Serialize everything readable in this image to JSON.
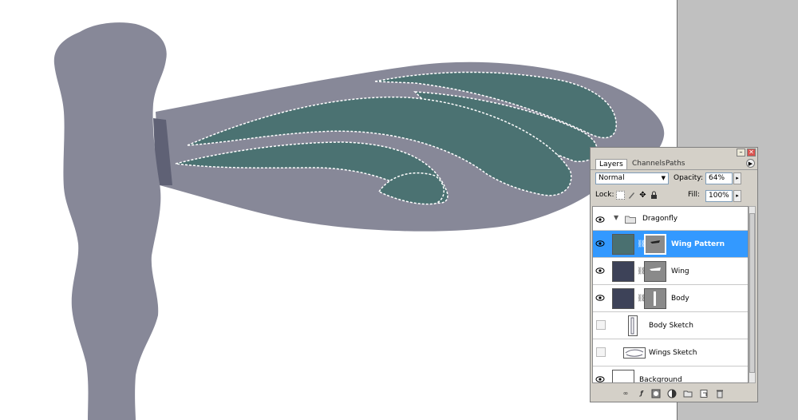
{
  "palette": {
    "tabs": [
      "Layers",
      "Channels",
      "Paths"
    ],
    "blend_mode": "Normal",
    "opacity_label": "Opacity:",
    "opacity_value": "64%",
    "lock_label": "Lock:",
    "fill_label": "Fill:",
    "fill_value": "100%"
  },
  "layers": [
    {
      "name": "Dragonfly",
      "kind": "group",
      "visible": true,
      "expanded": true
    },
    {
      "name": "Wing Pattern",
      "kind": "masked",
      "visible": true,
      "selected": true,
      "thumb_color": "#4a7070"
    },
    {
      "name": "Wing",
      "kind": "masked",
      "visible": true,
      "thumb_color": "#3d4258"
    },
    {
      "name": "Body",
      "kind": "masked",
      "visible": true,
      "thumb_color": "#3d4258"
    },
    {
      "name": "Body Sketch",
      "kind": "sketch",
      "visible": false
    },
    {
      "name": "Wings Sketch",
      "kind": "sketch",
      "visible": false
    },
    {
      "name": "Background",
      "kind": "background",
      "visible": true
    }
  ],
  "colors": {
    "body": "#878898",
    "wing_shadow": "#5f6175",
    "pattern": "#4b7272",
    "selection_blue": "#3399ff",
    "pasteboard": "#c0c0c0"
  },
  "icons": [
    "eye-icon",
    "folder-icon",
    "triangle-down-icon",
    "chain-link-icon",
    "palette-menu-icon",
    "link-layers-icon",
    "layer-style-icon",
    "mask-icon",
    "adjustment-icon",
    "new-group-icon",
    "new-layer-icon",
    "trash-icon"
  ]
}
